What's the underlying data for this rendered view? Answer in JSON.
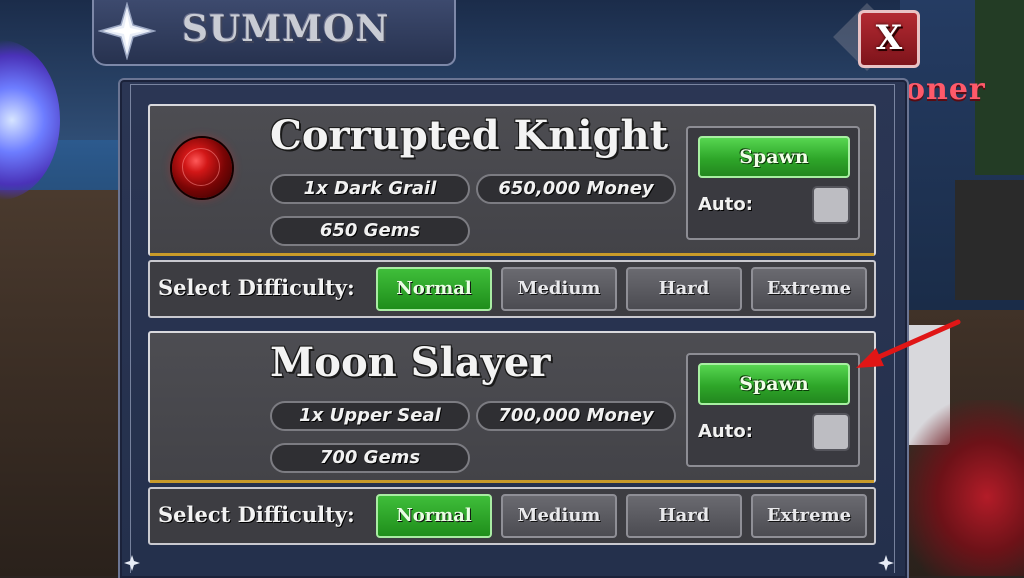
{
  "title": "SUMMON",
  "close_label": "X",
  "background_text": "oner",
  "bosses": [
    {
      "name": "Corrupted Knight",
      "requirements": [
        "1x Dark Grail",
        "650,000 Money",
        "650 Gems"
      ],
      "spawn_label": "Spawn",
      "auto_label": "Auto:",
      "auto_checked": false,
      "difficulty_label": "Select Difficulty:",
      "difficulties": [
        "Normal",
        "Medium",
        "Hard",
        "Extreme"
      ],
      "selected_difficulty": "Normal",
      "icon": "red-orb-icon"
    },
    {
      "name": "Moon Slayer",
      "requirements": [
        "1x Upper Seal",
        "700,000 Money",
        "700 Gems"
      ],
      "spawn_label": "Spawn",
      "auto_label": "Auto:",
      "auto_checked": false,
      "difficulty_label": "Select Difficulty:",
      "difficulties": [
        "Normal",
        "Medium",
        "Hard",
        "Extreme"
      ],
      "selected_difficulty": "Normal",
      "icon": ""
    }
  ],
  "colors": {
    "panel": "#24304c",
    "card": "#4a4a4f",
    "spawn_green": "#2ea629",
    "selected_green": "#2fa82a",
    "close_red": "#9c1f27",
    "card_underline": "#c89a2a",
    "annotation_arrow": "#e01616"
  }
}
